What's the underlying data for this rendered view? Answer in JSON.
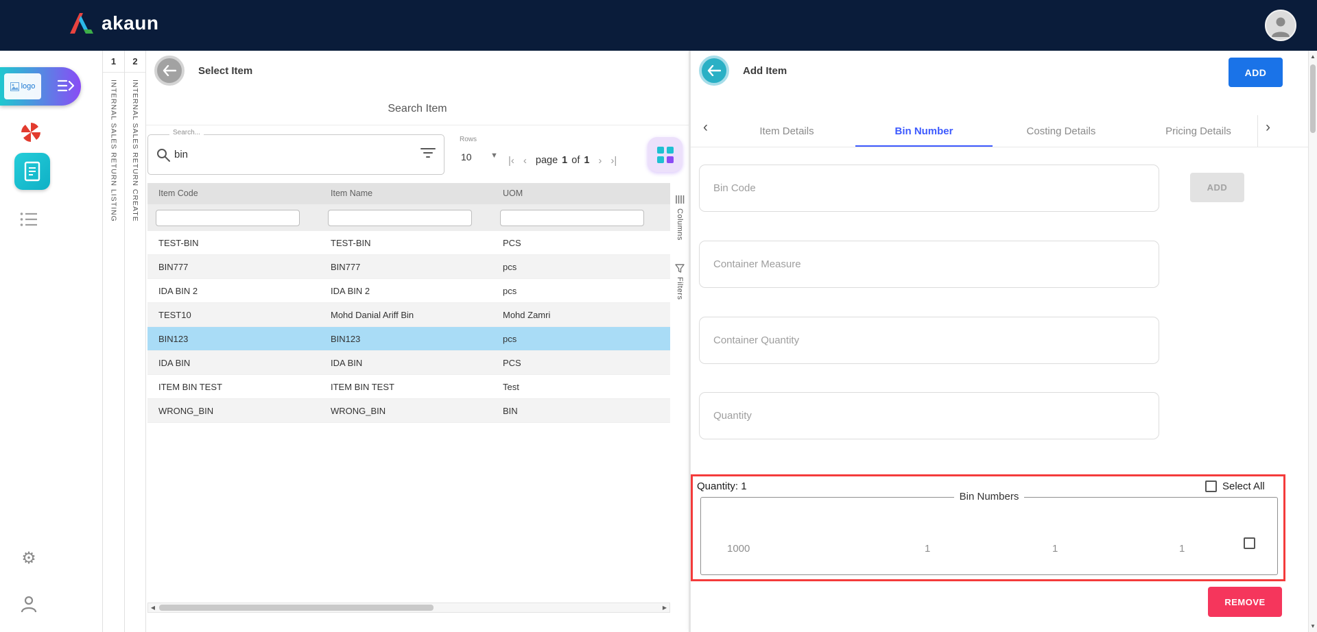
{
  "header": {
    "brand": "akaun"
  },
  "sidebar": {
    "logo_text": "logo"
  },
  "nav_strips": [
    {
      "num": "1",
      "label": "INTERNAL SALES RETURN LISTING"
    },
    {
      "num": "2",
      "label": "INTERNAL SALES RETURN CREATE"
    }
  ],
  "select_item": {
    "title": "Select Item",
    "heading": "Search Item",
    "search_label": "Search...",
    "search_value": "bin",
    "rows_label": "Rows",
    "rows_value": "10",
    "pagination": {
      "word_page": "page",
      "current": "1",
      "word_of": "of",
      "total": "1"
    },
    "table": {
      "columns": [
        "Item Code",
        "Item Name",
        "UOM"
      ],
      "rows": [
        [
          "TEST-BIN",
          "TEST-BIN",
          "PCS"
        ],
        [
          "BIN777",
          "BIN777",
          "pcs"
        ],
        [
          "IDA BIN 2",
          "IDA BIN 2",
          "pcs"
        ],
        [
          "TEST10",
          "Mohd Danial Ariff Bin",
          "Mohd Zamri"
        ],
        [
          "BIN123",
          "BIN123",
          "pcs"
        ],
        [
          "IDA BIN",
          "IDA BIN",
          "PCS"
        ],
        [
          "ITEM BIN TEST",
          "ITEM BIN TEST",
          "Test"
        ],
        [
          "WRONG_BIN",
          "WRONG_BIN",
          "BIN"
        ]
      ],
      "selected_index": 4
    },
    "tools": {
      "columns": "Columns",
      "filters": "Filters"
    }
  },
  "add_item": {
    "title": "Add Item",
    "add_button": "ADD",
    "tabs": [
      "Item Details",
      "Bin Number",
      "Costing Details",
      "Pricing Details"
    ],
    "active_tab": "Bin Number",
    "fields": [
      "Bin Code",
      "Container Measure",
      "Container Quantity",
      "Quantity"
    ],
    "bin_add_button": "ADD",
    "quantity_summary": "Quantity: 1",
    "select_all": "Select All",
    "bin_group_title": "Bin Numbers",
    "bin_values": [
      "1000",
      "1",
      "1",
      "1"
    ],
    "remove_button": "REMOVE"
  },
  "colors": {
    "header_bg": "#0a1c3a",
    "accent_blue": "#1a73e8",
    "tab_active": "#3d5afe",
    "selected_row": "#a9dcf6",
    "alert_border": "#f43b3b",
    "remove_red": "#f5365c",
    "teal": "#2ab0c5"
  }
}
